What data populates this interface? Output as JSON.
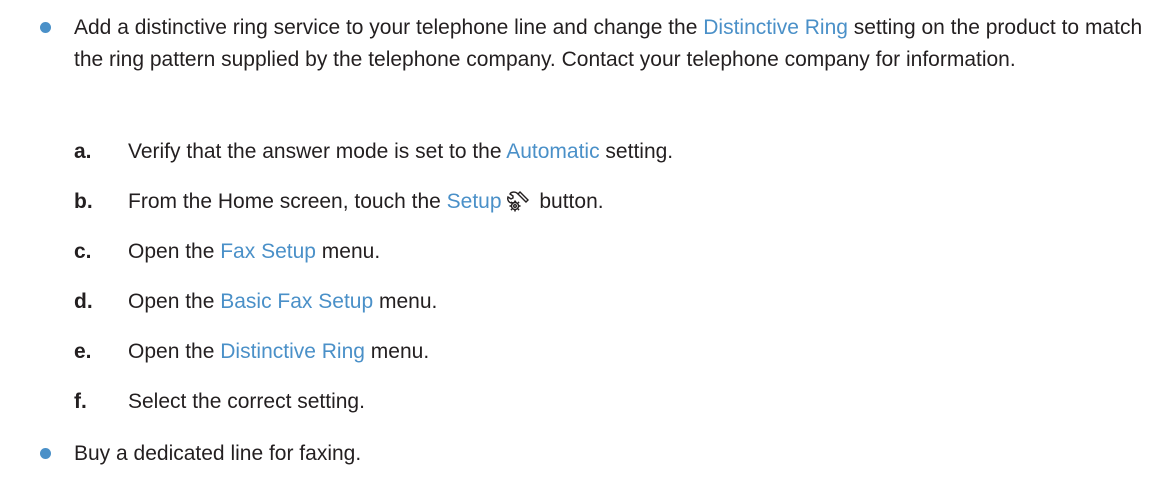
{
  "colors": {
    "accent": "#4a90c8",
    "text": "#231f20"
  },
  "bullet1": {
    "pre": "Add a distinctive ring service to your telephone line and change the ",
    "link": "Distinctive Ring",
    "post": " setting on the product to match the ring pattern supplied by the telephone company. Contact your telephone company for information."
  },
  "steps": [
    {
      "letter": "a.",
      "pre": "Verify that the answer mode is set to the ",
      "link": "Automatic",
      "post": " setting."
    },
    {
      "letter": "b.",
      "pre": "From the Home screen, touch the ",
      "link": "Setup",
      "icon": "setup-wrench-gear-icon",
      "post": " button."
    },
    {
      "letter": "c.",
      "pre": "Open the ",
      "link": "Fax Setup",
      "post": " menu."
    },
    {
      "letter": "d.",
      "pre": "Open the ",
      "link": "Basic Fax Setup",
      "post": " menu."
    },
    {
      "letter": "e.",
      "pre": "Open the ",
      "link": "Distinctive Ring",
      "post": " menu."
    },
    {
      "letter": "f.",
      "text": "Select the correct setting."
    }
  ],
  "bullet2": {
    "text": "Buy a dedicated line for faxing."
  }
}
